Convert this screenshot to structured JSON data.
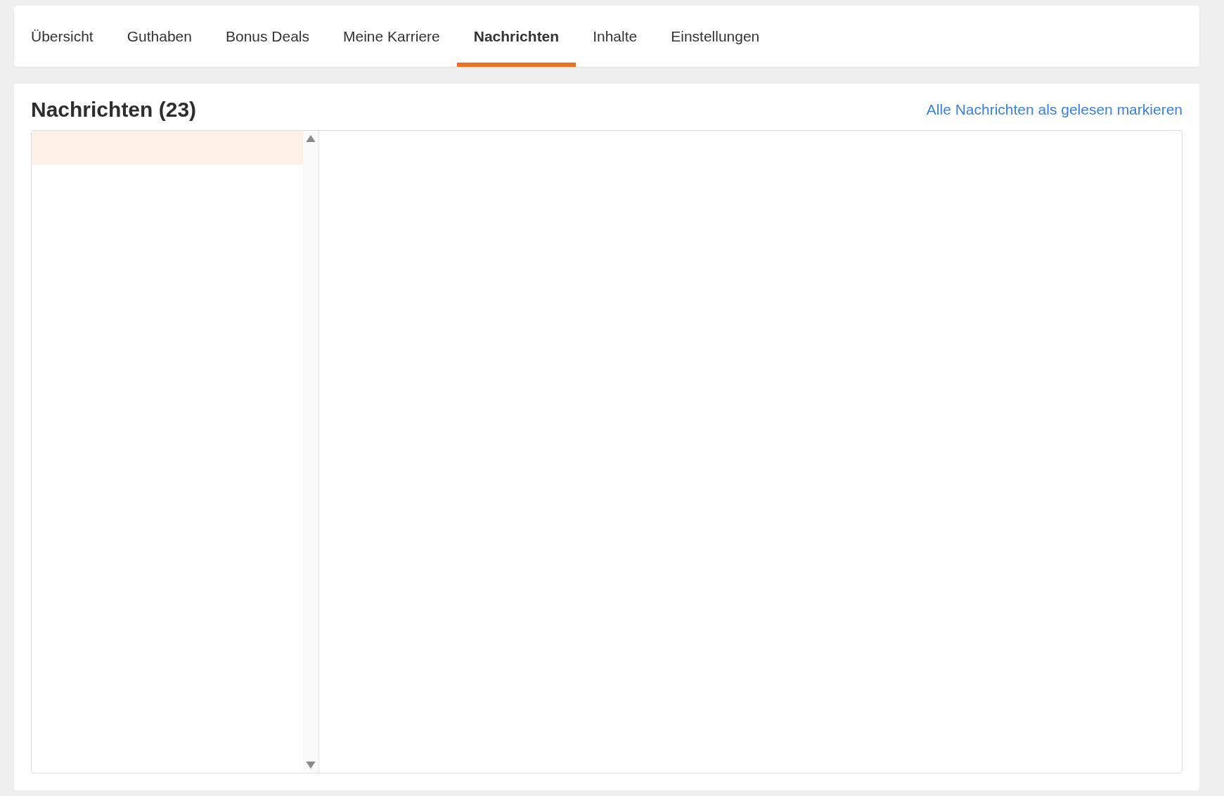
{
  "tabs": [
    {
      "label": "Übersicht",
      "selected": false
    },
    {
      "label": "Guthaben",
      "selected": false
    },
    {
      "label": "Bonus Deals",
      "selected": false
    },
    {
      "label": "Meine Karriere",
      "selected": false
    },
    {
      "label": "Nachrichten",
      "selected": true
    },
    {
      "label": "Inhalte",
      "selected": false
    },
    {
      "label": "Einstellungen",
      "selected": false
    }
  ],
  "messages": {
    "title": "Nachrichten (23)",
    "mark_all_link": "Alle Nachrichten als gelesen markieren",
    "list": [
      {
        "selected": true
      }
    ]
  }
}
